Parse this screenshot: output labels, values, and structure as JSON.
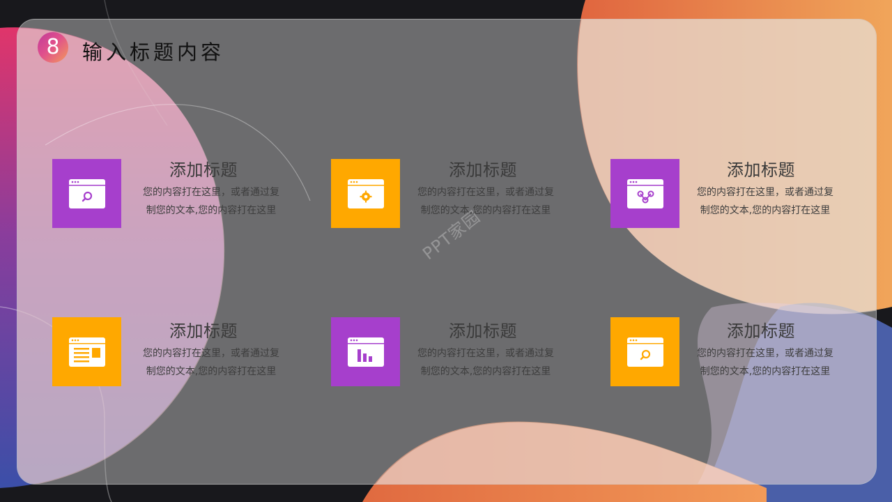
{
  "slide": {
    "badge_number": "8",
    "title": "输入标题内容",
    "watermark": "PPT家园"
  },
  "items": [
    {
      "title": "添加标题",
      "desc_line1": "您的内容打在这里，或者通过复",
      "desc_line2": "制您的文本,您的内容打在这里",
      "icon": "browser-search-icon",
      "color": "#a63fcc"
    },
    {
      "title": "添加标题",
      "desc_line1": "您的内容打在这里，或者通过复",
      "desc_line2": "制您的文本,您的内容打在这里",
      "icon": "browser-gear-icon",
      "color": "#ffa800"
    },
    {
      "title": "添加标题",
      "desc_line1": "您的内容打在这里，或者通过复",
      "desc_line2": "制您的文本,您的内容打在这里",
      "icon": "browser-network-icon",
      "color": "#a63fcc"
    },
    {
      "title": "添加标题",
      "desc_line1": "您的内容打在这里，或者通过复",
      "desc_line2": "制您的文本,您的内容打在这里",
      "icon": "browser-layout-icon",
      "color": "#ffa800"
    },
    {
      "title": "添加标题",
      "desc_line1": "您的内容打在这里，或者通过复",
      "desc_line2": "制您的文本,您的内容打在这里",
      "icon": "browser-chart-icon",
      "color": "#a63fcc"
    },
    {
      "title": "添加标题",
      "desc_line1": "您的内容打在这里，或者通过复",
      "desc_line2": "制您的文本,您的内容打在这里",
      "icon": "browser-search-icon",
      "color": "#ffa800"
    }
  ]
}
